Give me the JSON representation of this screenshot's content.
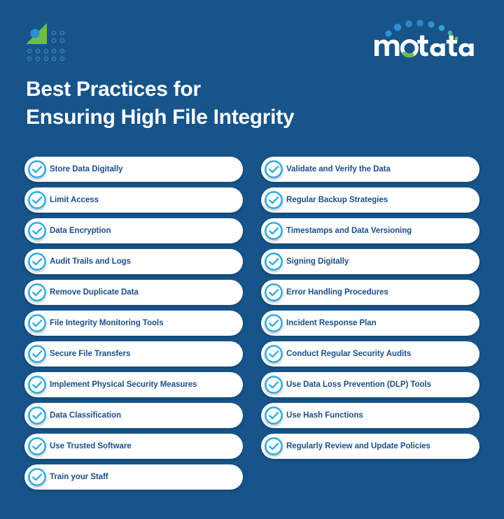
{
  "brand": {
    "mark_name": "motadata-triangle-dots-mark",
    "wordmark_text": "motadata",
    "colors": {
      "background": "#17548A",
      "green": "#6CBE45",
      "blue_dot": "#2E8FD4",
      "dot_outline": "#2E6FA3",
      "accent_cyan": "#2BABDF",
      "label_navy": "#1B4F8A",
      "pill_white": "#FFFFFF",
      "title_white": "#FFFFFF"
    }
  },
  "title": {
    "line1": "Best Practices for",
    "line2": "Ensuring High File Integrity"
  },
  "checklist": {
    "icon_name": "circle-check-icon",
    "left_column": [
      "Store Data Digitally",
      "Limit Access",
      "Data Encryption",
      "Audit Trails and Logs",
      "Remove Duplicate Data",
      "File Integrity Monitoring Tools",
      "Secure File Transfers",
      "Implement Physical Security Measures",
      "Data Classification",
      "Use Trusted Software",
      "Train your Staff"
    ],
    "right_column": [
      "Validate and Verify the Data",
      "Regular Backup Strategies",
      "Timestamps and Data Versioning",
      "Signing Digitally",
      "Error Handling Procedures",
      "Incident Response Plan",
      "Conduct Regular Security Audits",
      "Use Data Loss Prevention (DLP) Tools",
      "Use Hash Functions",
      "Regularly Review and Update Policies"
    ]
  }
}
